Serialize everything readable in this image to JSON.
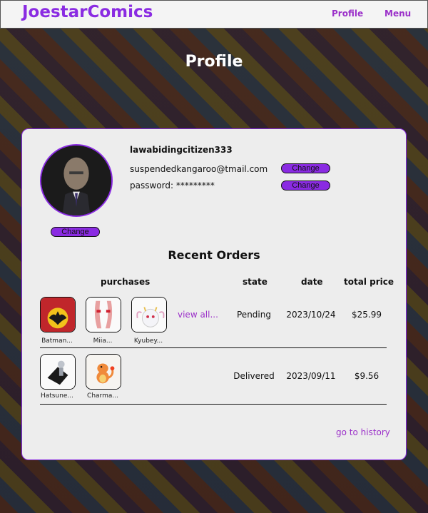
{
  "app": {
    "logo": "JoestarComics"
  },
  "nav": {
    "profile": "Profile",
    "menu": "Menu"
  },
  "page": {
    "title": "Profile"
  },
  "profile": {
    "username": "lawabidingcitizen333",
    "email": "suspendedkangaroo@tmail.com",
    "password_label": "password: *********",
    "change_label": "Change"
  },
  "orders": {
    "title": "Recent Orders",
    "columns": {
      "purchases": "purchases",
      "state": "state",
      "date": "date",
      "price": "total price"
    },
    "view_all": "view all...",
    "rows": [
      {
        "items": [
          {
            "caption": "Batman...",
            "icon": "batman-comic-icon"
          },
          {
            "caption": "Miia...",
            "icon": "miia-figure-icon"
          },
          {
            "caption": "Kyubey...",
            "icon": "kyubey-plush-icon"
          }
        ],
        "state": "Pending",
        "date": "2023/10/24",
        "price": "$25.99"
      },
      {
        "items": [
          {
            "caption": "Hatsune...",
            "icon": "hatsune-figure-icon"
          },
          {
            "caption": "Charma...",
            "icon": "charmander-figure-icon"
          }
        ],
        "state": "Delivered",
        "date": "2023/09/11",
        "price": "$9.56"
      }
    ],
    "history_link": "go to history"
  },
  "colors": {
    "accent": "#8a2be2",
    "card_bg": "#ededed",
    "nav_bg": "#f4f4f4"
  }
}
